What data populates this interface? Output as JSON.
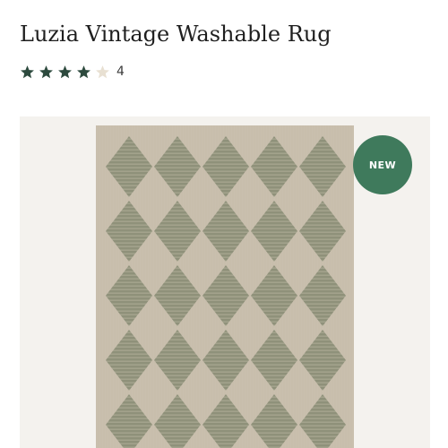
{
  "product": {
    "title": "Luzia Vintage Washable Rug",
    "rating": {
      "value": 4,
      "max": 5,
      "review_count": "4",
      "star_color": "#2d4a3e",
      "empty_star_color": "#e8e0d2"
    },
    "image": {
      "icon": "rug-image",
      "badge": "NEW",
      "badge_color": "#3f7a5c",
      "background_color": "#f4f2ee",
      "rug_base_color": "#c9bfae",
      "diamond_color": "#8a8d76"
    }
  }
}
